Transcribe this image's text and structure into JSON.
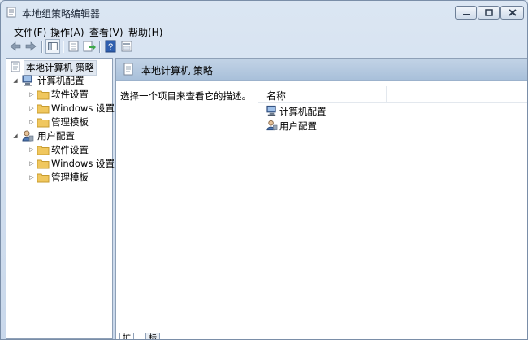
{
  "window": {
    "title": "本地组策略编辑器"
  },
  "menu": [
    "文件(F)",
    "操作(A)",
    "查看(V)",
    "帮助(H)"
  ],
  "toolbar": [
    "back-icon",
    "forward-icon",
    "show-hide-tree-icon",
    "properties-icon",
    "export-list-icon",
    "help-icon",
    "filter-icon"
  ],
  "tree": {
    "root": "本地计算机 策略",
    "computer": {
      "label": "计算机配置",
      "children": [
        "软件设置",
        "Windows 设置",
        "管理模板"
      ]
    },
    "user": {
      "label": "用户配置",
      "children": [
        "软件设置",
        "Windows 设置",
        "管理模板"
      ]
    }
  },
  "detail": {
    "header_title": "本地计算机 策略",
    "description": "选择一个项目来查看它的描述。",
    "column_name": "名称",
    "items": [
      "计算机配置",
      "用户配置"
    ]
  },
  "tabs": [
    "扩展",
    "标准"
  ],
  "colors": {
    "titlebar": "#dbe6f3",
    "header": "#b8cce2",
    "folder": "#f0c75e"
  }
}
